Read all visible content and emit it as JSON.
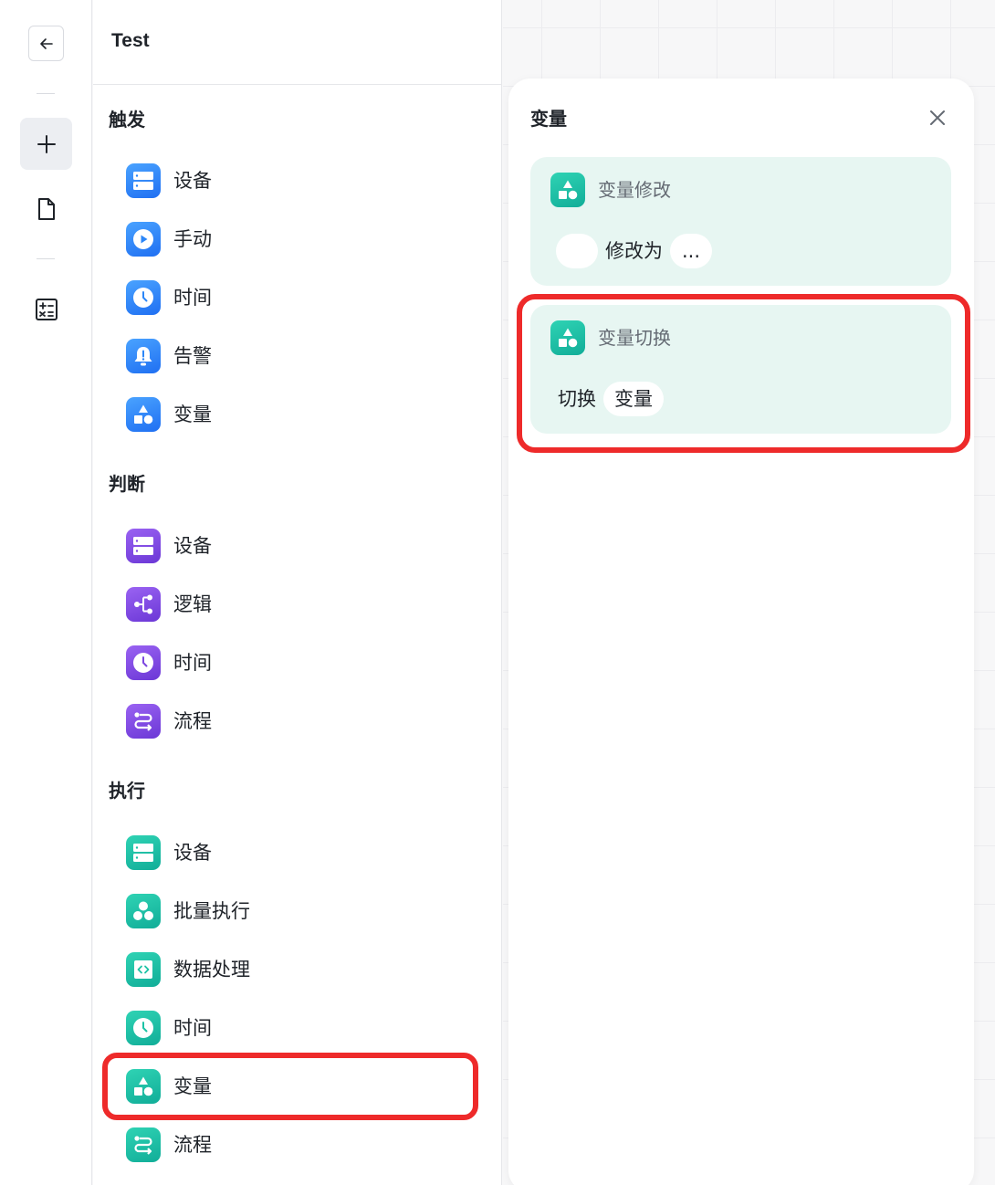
{
  "app": {
    "title": "Test"
  },
  "sections": [
    {
      "title": "触发",
      "items": [
        {
          "label": "设备",
          "icon": "server-icon"
        },
        {
          "label": "手动",
          "icon": "play-icon"
        },
        {
          "label": "时间",
          "icon": "clock-icon"
        },
        {
          "label": "告警",
          "icon": "bell-alert-icon"
        },
        {
          "label": "变量",
          "icon": "shapes-icon"
        }
      ]
    },
    {
      "title": "判断",
      "items": [
        {
          "label": "设备",
          "icon": "server-icon"
        },
        {
          "label": "逻辑",
          "icon": "branch-icon"
        },
        {
          "label": "时间",
          "icon": "clock-icon"
        },
        {
          "label": "流程",
          "icon": "flow-icon"
        }
      ]
    },
    {
      "title": "执行",
      "items": [
        {
          "label": "设备",
          "icon": "server-icon"
        },
        {
          "label": "批量执行",
          "icon": "circles-icon"
        },
        {
          "label": "数据处理",
          "icon": "code-icon"
        },
        {
          "label": "时间",
          "icon": "clock-icon"
        },
        {
          "label": "变量",
          "icon": "shapes-icon"
        },
        {
          "label": "流程",
          "icon": "flow-icon"
        }
      ]
    }
  ],
  "detail": {
    "title": "变量",
    "cards": [
      {
        "name": "变量修改",
        "text_modify": "修改为",
        "value_placeholder": "..."
      },
      {
        "name": "变量切换",
        "text_switch": "切换",
        "variable_pill": "变量"
      }
    ]
  },
  "colors": {
    "trigger": "#2b86f8",
    "judge": "#7c46e0",
    "action": "#1cc2a5",
    "highlight": "#ee2a2a",
    "card_bg": "#e7f6f2"
  }
}
